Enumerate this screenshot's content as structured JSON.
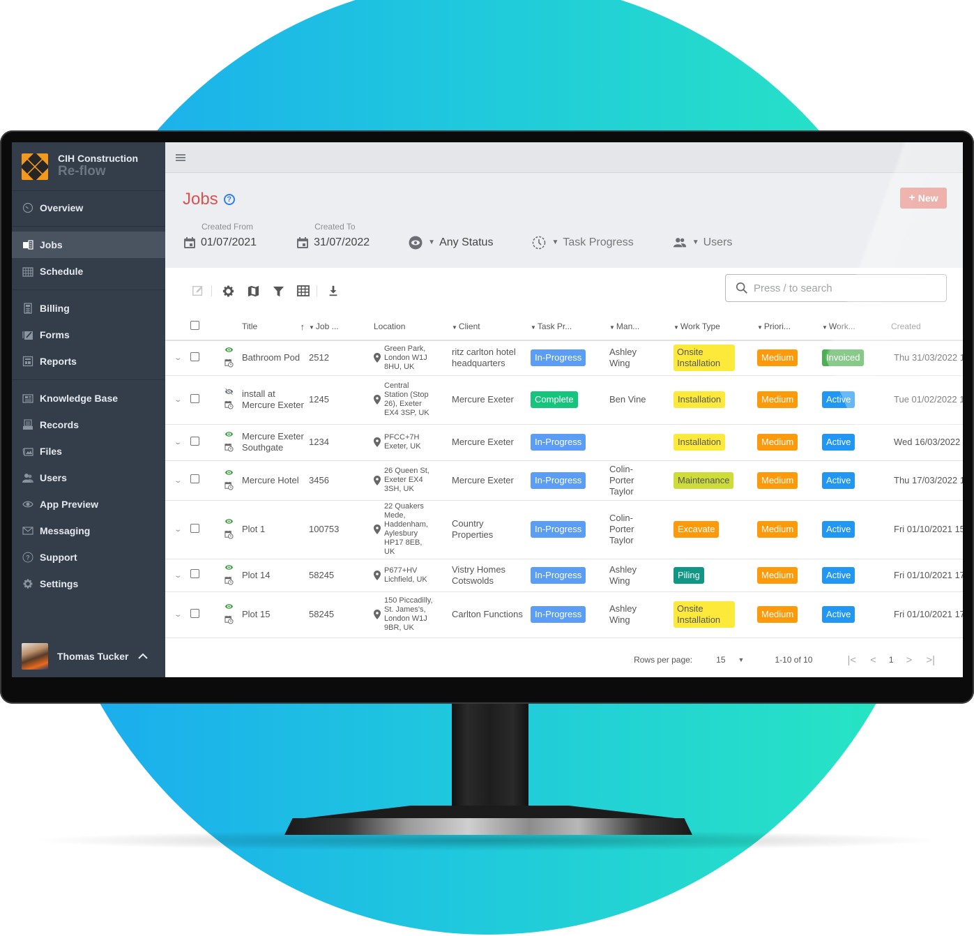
{
  "brand": {
    "name": "CIH Construction",
    "product": "Re-flow"
  },
  "sidebar": {
    "groups": [
      [
        {
          "label": "Overview",
          "icon": "gauge-icon"
        }
      ],
      [
        {
          "label": "Jobs",
          "icon": "jobs-icon",
          "active": true
        },
        {
          "label": "Schedule",
          "icon": "calendar-icon"
        }
      ],
      [
        {
          "label": "Billing",
          "icon": "calculator-icon"
        },
        {
          "label": "Forms",
          "icon": "forms-icon"
        },
        {
          "label": "Reports",
          "icon": "reports-icon"
        }
      ],
      [
        {
          "label": "Knowledge Base",
          "icon": "newspaper-icon"
        },
        {
          "label": "Records",
          "icon": "records-icon"
        },
        {
          "label": "Files",
          "icon": "images-icon"
        },
        {
          "label": "Users",
          "icon": "users-icon"
        },
        {
          "label": "App Preview",
          "icon": "eye-icon"
        },
        {
          "label": "Messaging",
          "icon": "envelope-icon"
        },
        {
          "label": "Support",
          "icon": "question-icon"
        },
        {
          "label": "Settings",
          "icon": "gear-icon"
        }
      ]
    ],
    "user": {
      "name": "Thomas Tucker"
    }
  },
  "header": {
    "title": "Jobs",
    "help": "?",
    "new_label": "New",
    "filters": {
      "created_from_label": "Created From",
      "created_from": "01/07/2021",
      "created_to_label": "Created To",
      "created_to": "31/07/2022",
      "status": "Any Status",
      "task_progress": "Task Progress",
      "users": "Users"
    }
  },
  "search": {
    "placeholder": "Press / to search"
  },
  "table": {
    "columns": [
      "Title",
      "Job ...",
      "Location",
      "Client",
      "Task Pr...",
      "Man...",
      "Work Type",
      "Priori...",
      "Work...",
      "Created"
    ],
    "rows": [
      {
        "visible": true,
        "title": "Bathroom Pod",
        "job": "2512",
        "location": "Green Park, London W1J 8HU, UK",
        "client": "ritz carlton hotel headquarters",
        "task": "In-Progress",
        "task_class": "b-inprogress",
        "manager": "Ashley Wing",
        "work_type": "Onsite Installation",
        "wt_class": "b-yellow multi",
        "priority": "Medium",
        "work_status": "Invoiced",
        "ws_class": "b-invoiced",
        "created": "Thu 31/03/2022 1"
      },
      {
        "visible": false,
        "title": "install at Mercure Exeter",
        "job": "1245",
        "location": "Central Station (Stop 26), Exeter EX4 3SP, UK",
        "client": "Mercure Exeter",
        "task": "Complete",
        "task_class": "b-complete",
        "manager": "Ben Vine",
        "work_type": "Installation",
        "wt_class": "b-yellow",
        "priority": "Medium",
        "work_status": "Active",
        "ws_class": "b-active",
        "created": "Tue 01/02/2022 1"
      },
      {
        "visible": true,
        "title": "Mercure Exeter Southgate",
        "job": "1234",
        "location": "PFCC+7H Exeter, UK",
        "client": "Mercure Exeter",
        "task": "In-Progress",
        "task_class": "b-inprogress",
        "manager": "",
        "work_type": "Installation",
        "wt_class": "b-yellow",
        "priority": "Medium",
        "work_status": "Active",
        "ws_class": "b-active",
        "created": "Wed 16/03/2022"
      },
      {
        "visible": true,
        "title": "Mercure Hotel",
        "job": "3456",
        "location": "26 Queen St, Exeter EX4 3SH, UK",
        "client": "Mercure Exeter",
        "task": "In-Progress",
        "task_class": "b-inprogress",
        "manager": "Colin-Porter Taylor",
        "work_type": "Maintenance",
        "wt_class": "b-lime",
        "priority": "Medium",
        "work_status": "Active",
        "ws_class": "b-active",
        "created": "Thu 17/03/2022 1"
      },
      {
        "visible": true,
        "title": "Plot 1",
        "job": "100753",
        "location": "22 Quakers Mede, Haddenham, Aylesbury HP17 8EB, UK",
        "client": "Country Properties",
        "task": "In-Progress",
        "task_class": "b-inprogress",
        "manager": "Colin-Porter Taylor",
        "work_type": "Excavate",
        "wt_class": "b-orange",
        "priority": "Medium",
        "work_status": "Active",
        "ws_class": "b-active",
        "created": "Fri 01/10/2021 15"
      },
      {
        "visible": true,
        "title": "Plot 14",
        "job": "58245",
        "location": "P677+HV Lichfield, UK",
        "client": "Vistry Homes Cotswolds",
        "task": "In-Progress",
        "task_class": "b-inprogress",
        "manager": "Ashley Wing",
        "work_type": "Piling",
        "wt_class": "b-teal",
        "priority": "Medium",
        "work_status": "Active",
        "ws_class": "b-active",
        "created": "Fri 01/10/2021 17"
      },
      {
        "visible": true,
        "title": "Plot 15",
        "job": "58245",
        "location": "150 Piccadilly, St. James's, London W1J 9BR, UK",
        "client": "Carlton Functions",
        "task": "In-Progress",
        "task_class": "b-inprogress",
        "manager": "Ashley Wing",
        "work_type": "Onsite Installation",
        "wt_class": "b-yellow multi",
        "priority": "Medium",
        "work_status": "Active",
        "ws_class": "b-active",
        "created": "Fri 01/10/2021 17"
      }
    ]
  },
  "pagination": {
    "rows_per_page_label": "Rows per page:",
    "rows_per_page": "15",
    "range": "1-10 of 10",
    "page": "1"
  },
  "colors": {
    "accent": "#d9534f",
    "sidebar": "#343e4b",
    "new_button": "#e78f86",
    "in_progress": "#5b9df5",
    "complete": "#16c47e",
    "active": "#2196f3",
    "invoiced": "#4caf50",
    "medium": "#fb9a0b"
  }
}
